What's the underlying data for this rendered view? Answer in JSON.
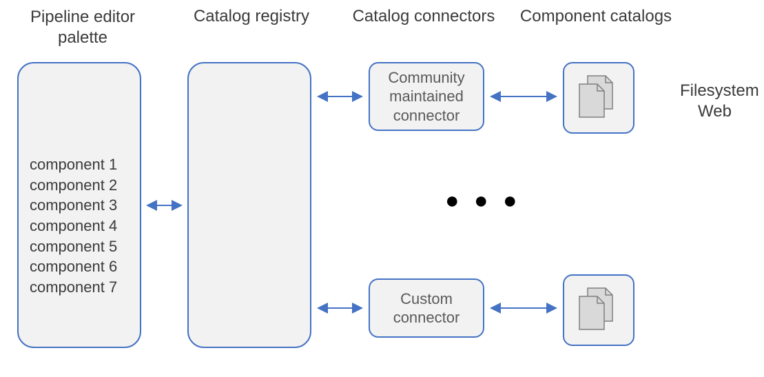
{
  "headers": {
    "palette": "Pipeline editor\npalette",
    "registry": "Catalog registry",
    "connectors": "Catalog connectors",
    "catalogs": "Component catalogs"
  },
  "palette_items": [
    "component 1",
    "component 2",
    "component 3",
    "component 4",
    "component 5",
    "component 6",
    "component 7"
  ],
  "connector_top": "Community\nmaintained\nconnector",
  "connector_bottom": "Custom\nconnector",
  "side_labels": {
    "line1": "Filesystem",
    "line2": "Web"
  },
  "ellipsis": "● ● ●",
  "colors": {
    "box_border": "#4472c4",
    "box_fill": "#f2f2f2",
    "arrow": "#4472c4",
    "doc_fill": "#d9d9d9",
    "doc_stroke": "#7f7f7f"
  }
}
